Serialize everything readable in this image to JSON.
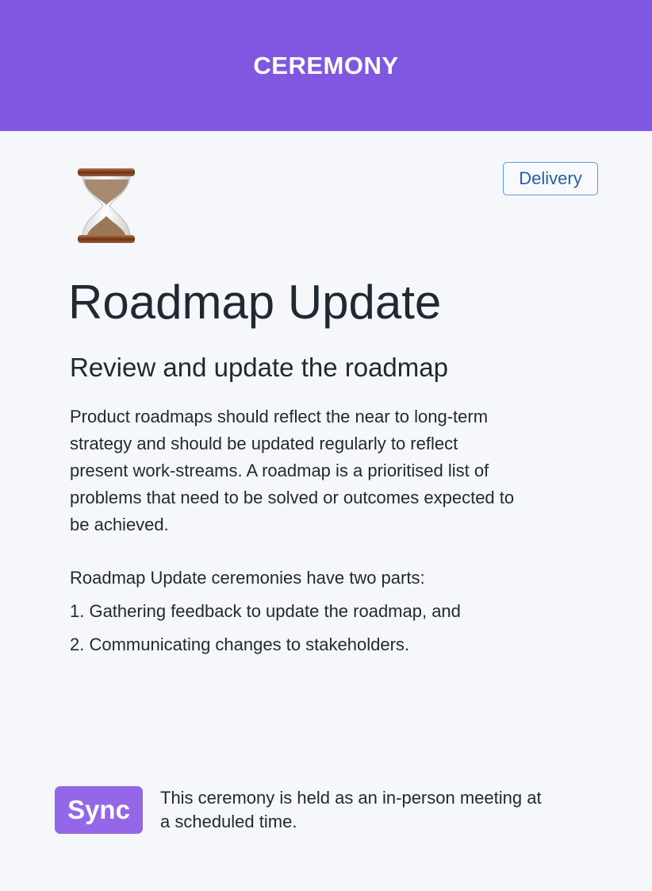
{
  "header": {
    "title": "CEREMONY"
  },
  "card": {
    "icon": "hourglass-icon",
    "tag": "Delivery",
    "title": "Roadmap Update",
    "subtitle": "Review and update the roadmap",
    "description_lines": [
      "Product roadmaps should reflect the near to long-term",
      "strategy and should be updated regularly to reflect",
      "present work-streams. A roadmap is a prioritised list of",
      "problems that need to be solved or outcomes expected to",
      "be achieved."
    ],
    "parts": [
      "Roadmap Update ceremonies have two parts:",
      "1. Gathering feedback to update the roadmap, and",
      "2. Communicating changes to stakeholders."
    ],
    "sync": {
      "label": "Sync",
      "description_lines": [
        "This ceremony is held as an in-person meeting at",
        "a scheduled time."
      ]
    }
  },
  "colors": {
    "header": "#7f57e0",
    "sync": "#9466e8",
    "tag_border": "#5b9be0"
  }
}
